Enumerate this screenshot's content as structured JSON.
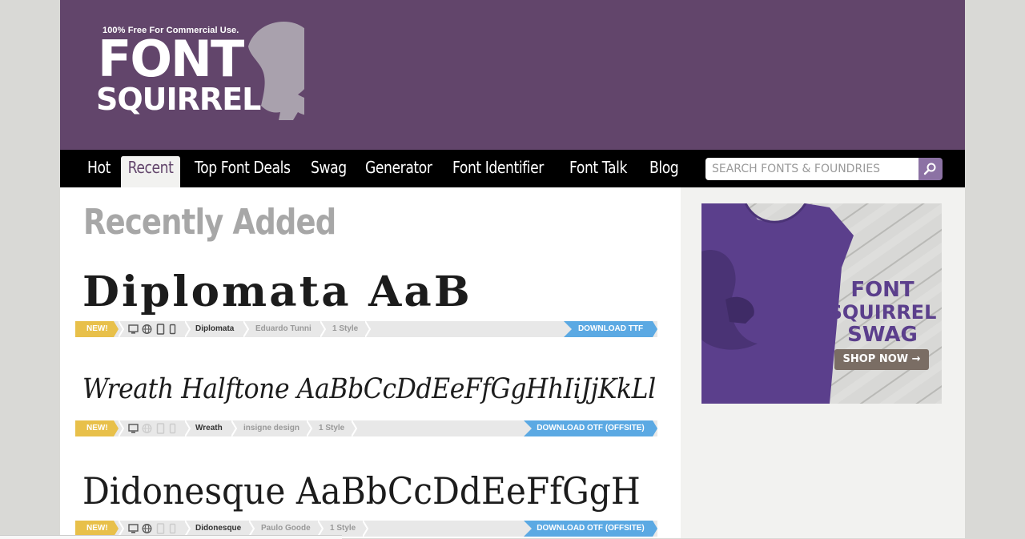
{
  "header": {
    "logo_tagline": "100% Free For Commercial Use.",
    "logo_word1": "FONT",
    "logo_word2": "SQUIRREL"
  },
  "nav": {
    "items": [
      "Hot",
      "Recent",
      "Top Font Deals",
      "Swag",
      "Generator",
      "Font Identifier",
      "Font Talk",
      "Blog"
    ],
    "active": "Recent"
  },
  "search": {
    "placeholder": "SEARCH FONTS & FOUNDRIES"
  },
  "main": {
    "heading": "Recently Added",
    "fonts": [
      {
        "sample": "Diplomata AaB",
        "badge": "NEW!",
        "name": "Diplomata",
        "foundry": "Eduardo Tunni",
        "styles": "1 Style",
        "download": "DOWNLOAD TTF"
      },
      {
        "sample": "Wreath Halftone AaBbCcDdEeFfGgHhIiJjKkLl",
        "badge": "NEW!",
        "name": "Wreath",
        "foundry": "insigne design",
        "styles": "1 Style",
        "download": "DOWNLOAD OTF (OFFSITE)"
      },
      {
        "sample": "Didonesque AaBbCcDdEeFfGgH",
        "badge": "NEW!",
        "name": "Didonesque",
        "foundry": "Paulo Goode",
        "styles": "1 Style",
        "download": "DOWNLOAD OTF (OFFSITE)"
      }
    ]
  },
  "ad": {
    "line1": "FONT",
    "line2": "SQUIRREL",
    "line3": "SWAG",
    "button": "SHOP NOW"
  },
  "colors": {
    "header_purple": "#62456b",
    "badge_yellow": "#e8c04a",
    "download_blue": "#5ba9e3",
    "search_button": "#8c72a4",
    "tshirt_purple": "#5b3f8c"
  }
}
